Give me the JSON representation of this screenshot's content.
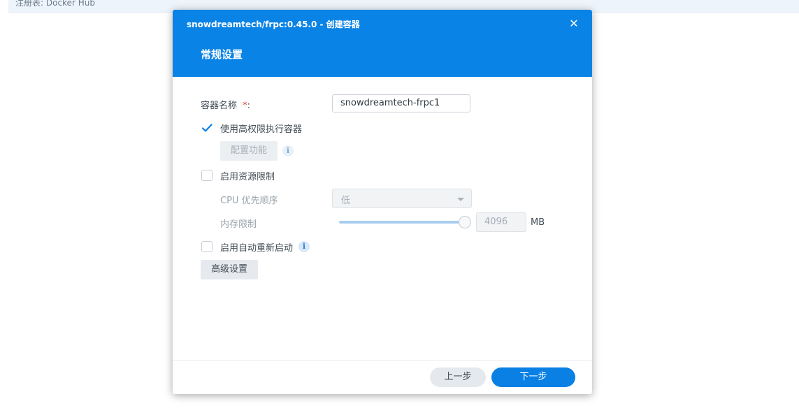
{
  "background": {
    "registry_text": "注册表: Docker Hub"
  },
  "dialog": {
    "title": "snowdreamtech/frpc:0.45.0 - 创建容器",
    "close_icon": "close-icon",
    "step_title": "常规设置",
    "header_color": "#0a83e6",
    "form": {
      "container_name_label": "容器名称",
      "required_mark": "*",
      "colon": ":",
      "container_name_value": "snowdreamtech-frpc1",
      "privileged_label": "使用高权限执行容器",
      "privileged_checked": true,
      "capabilities_button": "配置功能",
      "capabilities_info_icon": "info-icon",
      "resource_limit_label": "启用资源限制",
      "resource_limit_checked": false,
      "cpu_priority_label": "CPU 优先顺序",
      "cpu_priority_value": "低",
      "memory_limit_label": "内存限制",
      "memory_limit_value": "4096",
      "memory_limit_fraction": 1.0,
      "memory_unit": "MB",
      "auto_restart_label": "启用自动重新启动",
      "auto_restart_checked": false,
      "auto_restart_info_icon": "info-icon",
      "advanced_button": "高级设置"
    },
    "footer": {
      "prev_label": "上一步",
      "next_label": "下一步",
      "next_color": "#0a7fe4"
    }
  }
}
